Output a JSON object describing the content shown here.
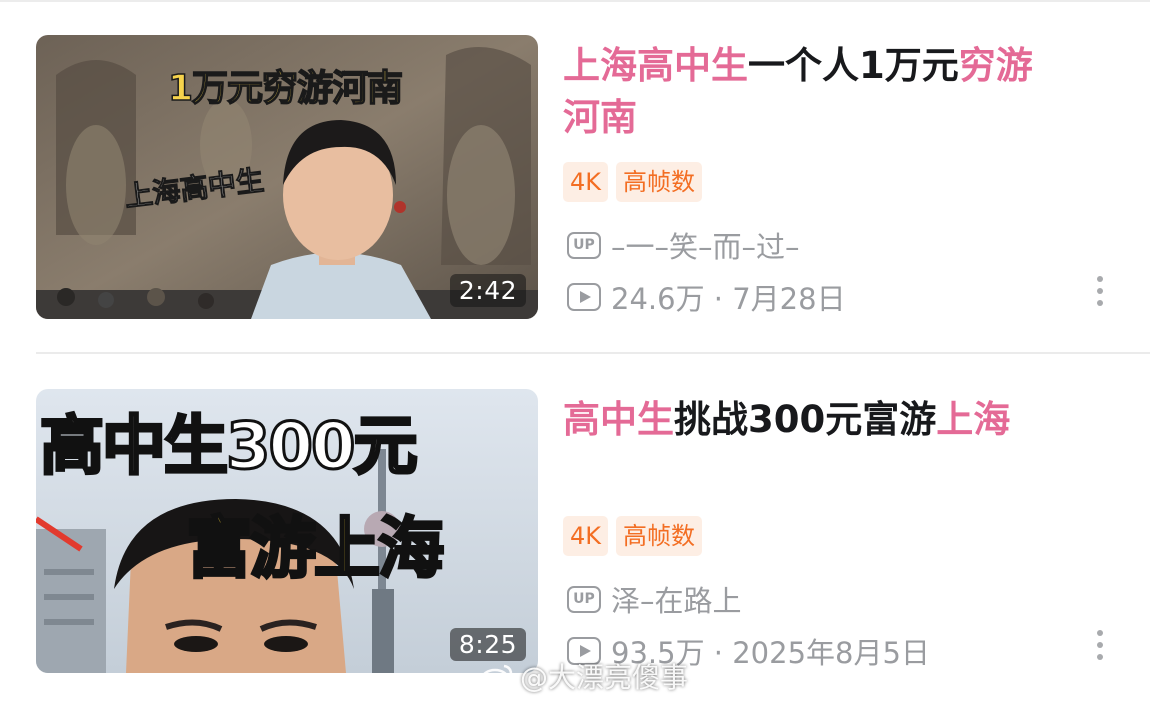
{
  "videos": [
    {
      "thumb_text_top": "1万元穷游河南",
      "thumb_text_side": "上海高中生",
      "duration": "2:42",
      "title_parts": [
        "上海高中生",
        "一个人1万元",
        "穷游",
        "河南"
      ],
      "badges": [
        "4K",
        "高帧数"
      ],
      "uploader": "–一–笑–而–过–",
      "views": "24.6万",
      "date": "7月28日",
      "stats": "24.6万 · 7月28日"
    },
    {
      "thumb_text_top": "高中生300元",
      "thumb_text_side": "富游上海",
      "duration": "8:25",
      "title_parts": [
        "高中生",
        "挑战300元富游",
        "上海"
      ],
      "badges": [
        "4K",
        "高帧数"
      ],
      "uploader": "泽–在路上",
      "views": "93.5万",
      "date": "2025年8月5日",
      "stats": "93.5万 · 2025年8月5日"
    }
  ],
  "watermark": "@大漂亮傻事",
  "icons": {
    "uploader": "up-icon",
    "views": "play-count-icon",
    "more": "more-vertical-icon"
  },
  "colors": {
    "highlight": "#e46a96",
    "badge_text": "#f36e23",
    "badge_bg": "#fdeee4",
    "meta_gray": "#9a9ca0"
  }
}
